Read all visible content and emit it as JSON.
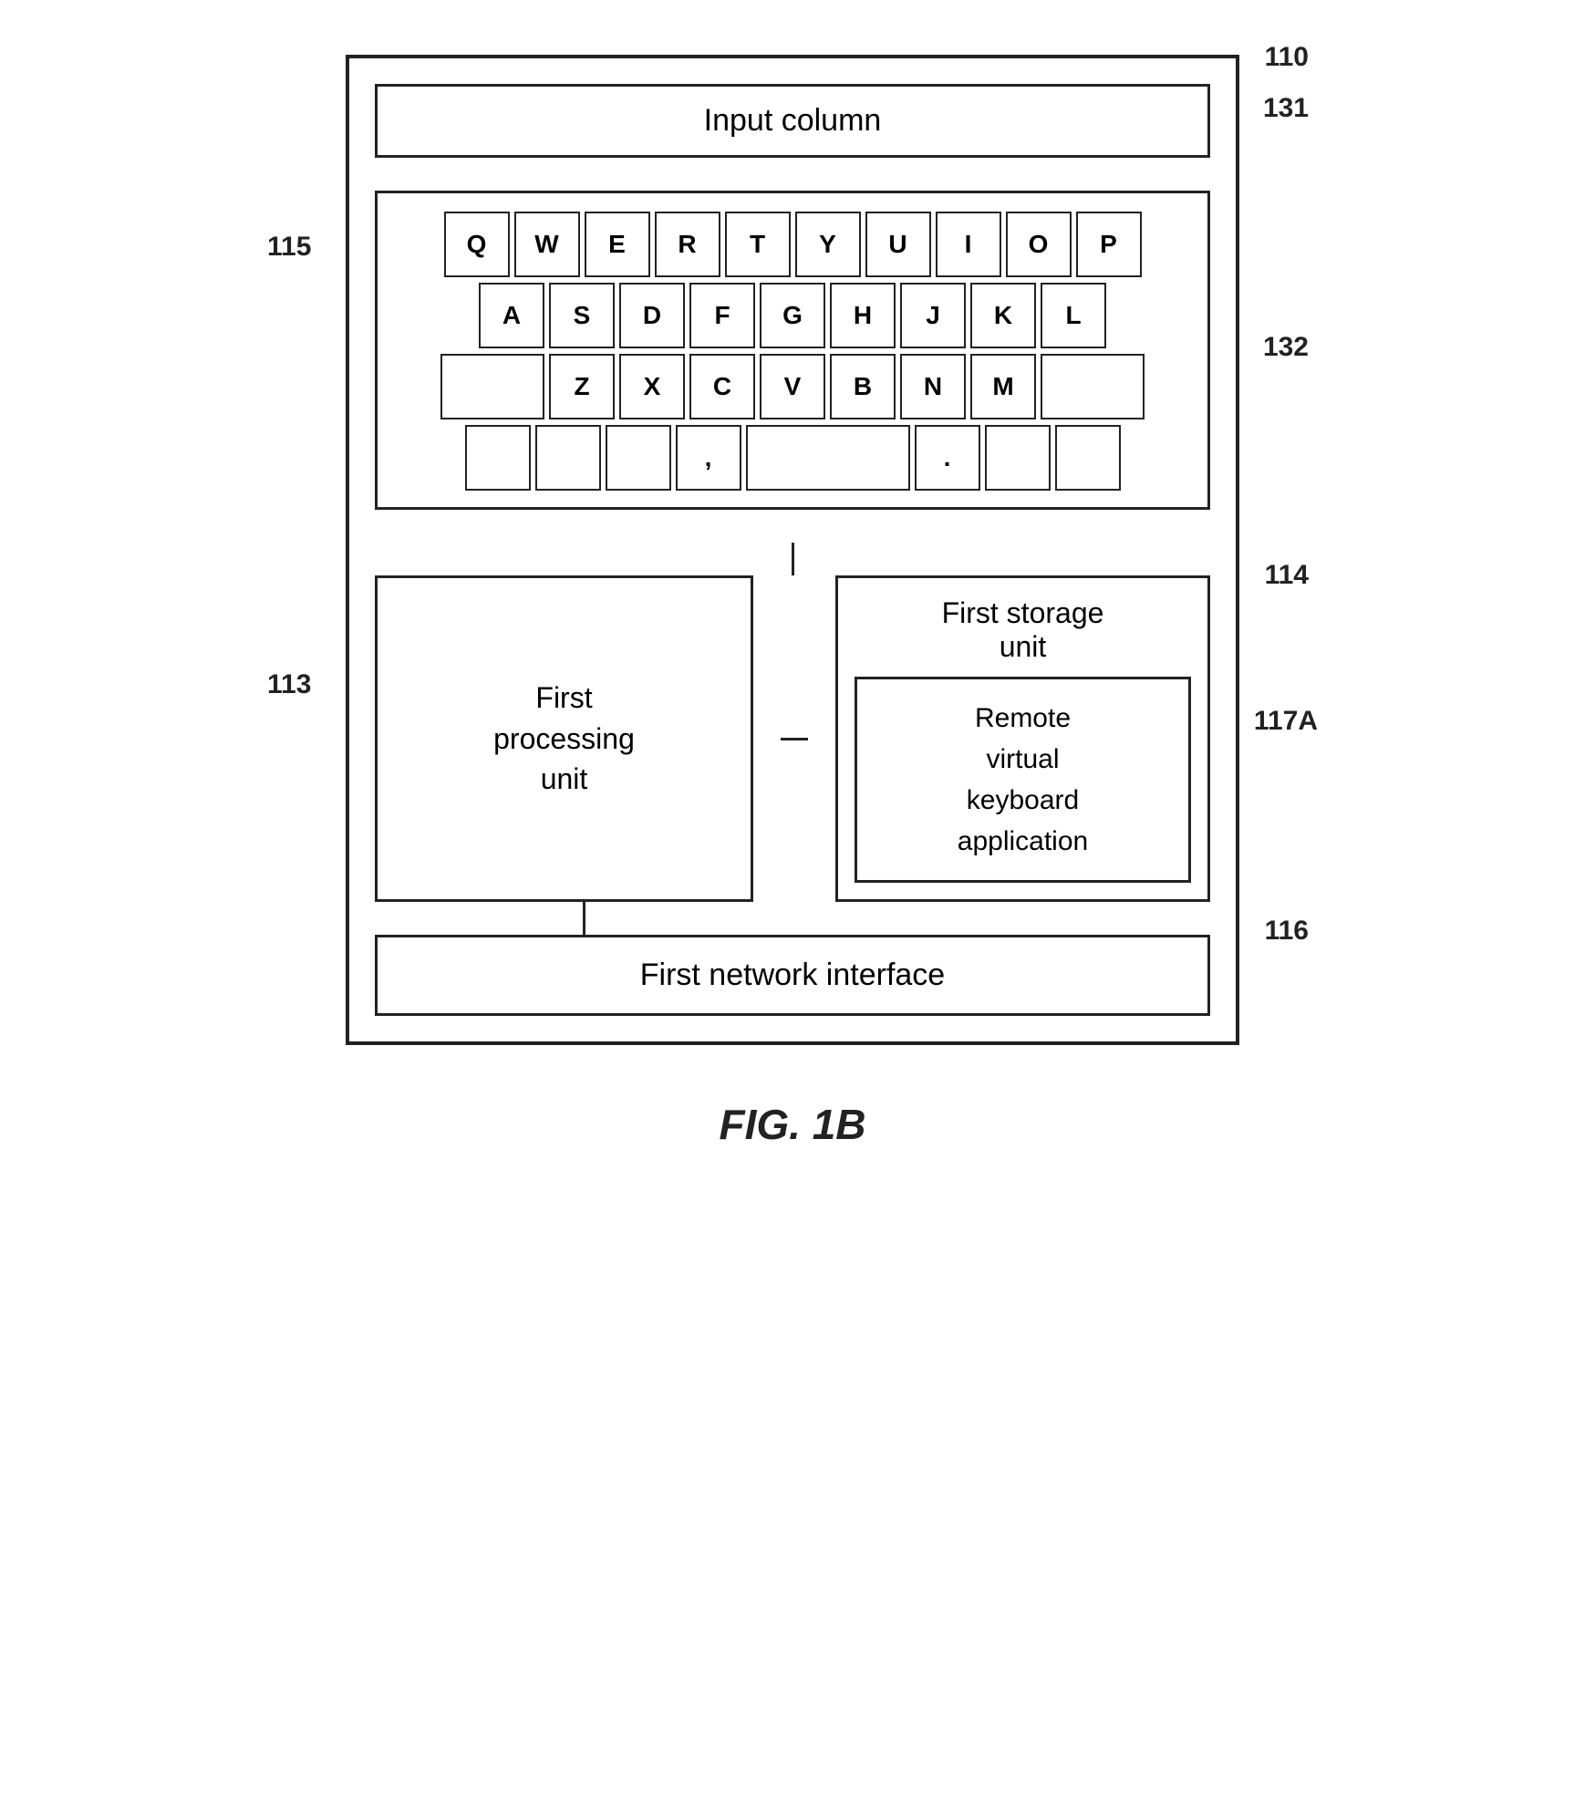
{
  "diagram": {
    "figure_label": "FIG. 1B",
    "ref_numbers": {
      "outer_box": "110",
      "input_column": "131",
      "keyboard_area": "132",
      "keyboard_label": "115",
      "first_processing_unit": "113",
      "first_storage_unit": "114",
      "rvka": "117A",
      "first_network_interface": "116"
    },
    "input_column_text": "Input column",
    "keyboard_rows": [
      [
        "Q",
        "W",
        "E",
        "R",
        "T",
        "Y",
        "U",
        "I",
        "O",
        "P"
      ],
      [
        "A",
        "S",
        "D",
        "F",
        "G",
        "H",
        "J",
        "K",
        "L"
      ],
      [
        "",
        "Z",
        "X",
        "C",
        "V",
        "B",
        "N",
        "M",
        ""
      ],
      [
        "",
        "",
        "",
        ",",
        " ",
        ".",
        "",
        ""
      ]
    ],
    "first_processing_unit_text": "First\nprocessing\nunit",
    "first_storage_unit_text": "First storage\nunit",
    "remote_vka_text": "Remote\nvirtual\nkeyboard\napplication",
    "first_network_interface_text": "First network interface"
  }
}
